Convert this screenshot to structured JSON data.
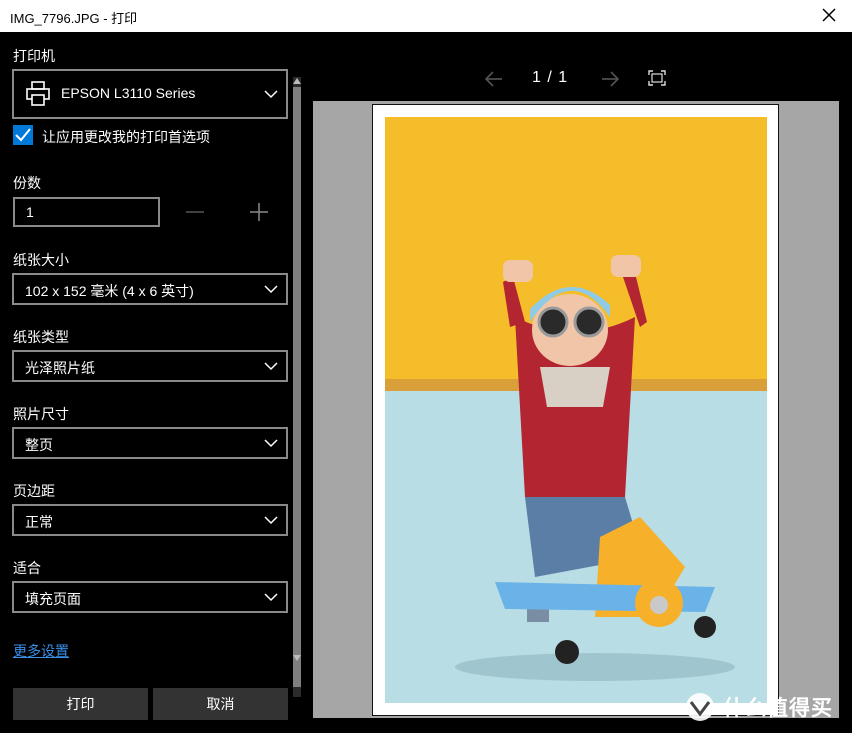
{
  "window": {
    "title": "IMG_7796.JPG - 打印"
  },
  "printer": {
    "label": "打印机",
    "selected": "EPSON L3110 Series",
    "icon": "printer-icon"
  },
  "app_prefs": {
    "checked": true,
    "label": "让应用更改我的打印首选项"
  },
  "copies": {
    "label": "份数",
    "value": "1"
  },
  "paper_size": {
    "label": "纸张大小",
    "selected": "102 x 152 毫米 (4 x 6 英寸)"
  },
  "paper_type": {
    "label": "纸张类型",
    "selected": "光泽照片纸"
  },
  "photo_size": {
    "label": "照片尺寸",
    "selected": "整页"
  },
  "margins": {
    "label": "页边距",
    "selected": "正常"
  },
  "fit": {
    "label": "适合",
    "selected": "填充页面"
  },
  "more_settings": "更多设置",
  "buttons": {
    "print": "打印",
    "cancel": "取消"
  },
  "preview": {
    "page_indicator": "1 / 1"
  },
  "watermark": {
    "text": "什么值得买"
  },
  "colors": {
    "accent": "#0078d7",
    "link": "#3a8fe8",
    "panel_bg": "#000000",
    "preview_bg": "#a6a6a6",
    "button_bg": "#333333",
    "photo_wall": "#f6bd2b",
    "photo_floor": "#b9dde4",
    "sweater": "#b32530"
  }
}
